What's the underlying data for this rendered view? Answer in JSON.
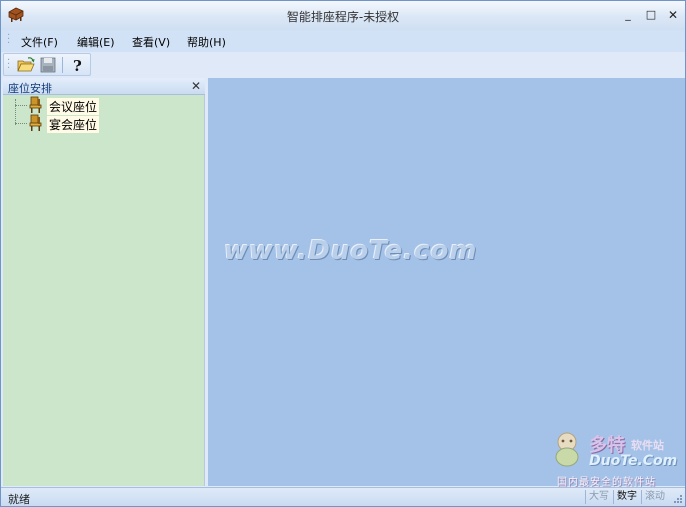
{
  "window": {
    "title": "智能排座程序-未授权"
  },
  "controls": {
    "minimize": "_",
    "maximize": "□",
    "close": "✕"
  },
  "menu": [
    "文件(F)",
    "编辑(E)",
    "查看(V)",
    "帮助(H)"
  ],
  "toolbar": {
    "buttons": [
      "open-folder-icon",
      "save-icon",
      "help-icon"
    ]
  },
  "panel": {
    "title": "座位安排",
    "close": "✕",
    "tree": [
      "会议座位",
      "宴会座位"
    ]
  },
  "watermark": "www.DuoTe.com",
  "logo": {
    "main": "多特",
    "sub": "软件站",
    "url": "DuoTe.Com",
    "tag": "国内最安全的软件站"
  },
  "statusbar": {
    "text": "就绪",
    "indicators": [
      "大写",
      "数字",
      "滚动"
    ],
    "active": "数字"
  }
}
